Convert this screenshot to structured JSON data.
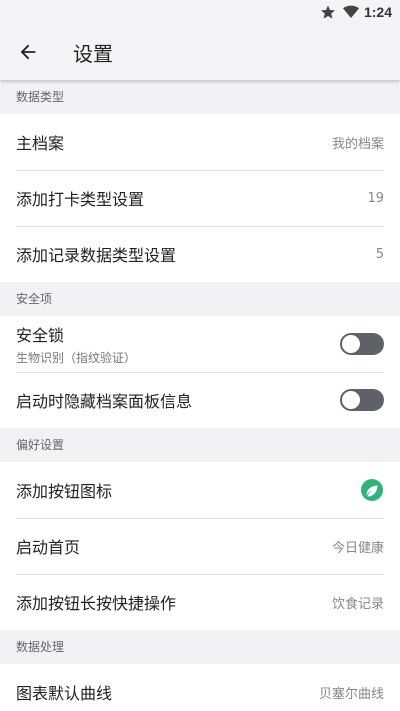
{
  "status_bar": {
    "time": "1:24",
    "icons": [
      "star-icon",
      "wifi-icon"
    ]
  },
  "app_bar": {
    "title": "设置",
    "back_icon": "arrow-back-icon"
  },
  "sections": {
    "data_types": {
      "header": "数据类型",
      "profile": {
        "title": "主档案",
        "value": "我的档案"
      },
      "checkin_types": {
        "title": "添加打卡类型设置",
        "value": "19"
      },
      "record_types": {
        "title": "添加记录数据类型设置",
        "value": "5"
      }
    },
    "security": {
      "header": "安全项",
      "lock": {
        "title": "安全锁",
        "subtitle": "生物识别（指纹验证）",
        "enabled": false
      },
      "hide_panel": {
        "title": "启动时隐藏档案面板信息",
        "enabled": false
      }
    },
    "preferences": {
      "header": "偏好设置",
      "add_button_icon": {
        "title": "添加按钮图标",
        "icon": "leaf-icon",
        "icon_color": "#2fb37a"
      },
      "start_page": {
        "title": "启动首页",
        "value": "今日健康"
      },
      "long_press": {
        "title": "添加按钮长按快捷操作",
        "value": "饮食记录"
      }
    },
    "data_processing": {
      "header": "数据处理",
      "chart_curve": {
        "title": "图表默认曲线",
        "value": "贝塞尔曲线"
      }
    }
  },
  "colors": {
    "toggle_off": "#5e6165",
    "background": "#f2f2f4",
    "accent_leaf": "#2fb37a"
  }
}
